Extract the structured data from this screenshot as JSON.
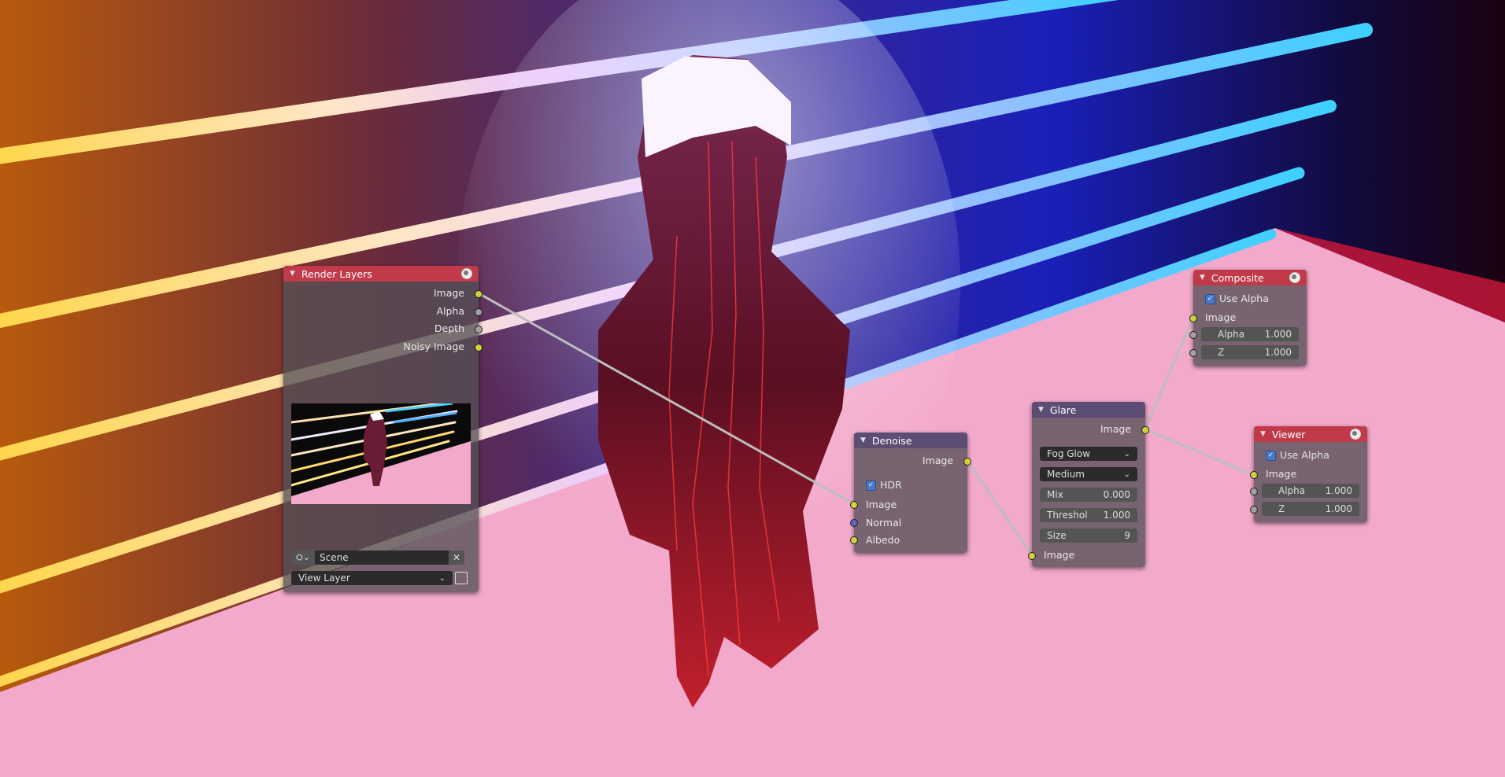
{
  "nodes": {
    "render_layers": {
      "title": "Render Layers",
      "outputs": [
        "Image",
        "Alpha",
        "Depth",
        "Noisy Image"
      ],
      "scene": "Scene",
      "view_layer": "View Layer"
    },
    "denoise": {
      "title": "Denoise",
      "output": "Image",
      "hdr_label": "HDR",
      "inputs": [
        "Image",
        "Normal",
        "Albedo"
      ]
    },
    "glare": {
      "title": "Glare",
      "output": "Image",
      "type": "Fog Glow",
      "quality": "Medium",
      "mix_label": "Mix",
      "mix": "0.000",
      "threshold_label": "Threshol",
      "threshold": "1.000",
      "size_label": "Size",
      "size": "9",
      "input": "Image"
    },
    "composite": {
      "title": "Composite",
      "use_alpha": "Use Alpha",
      "input": "Image",
      "alpha_label": "Alpha",
      "alpha": "1.000",
      "z_label": "Z",
      "z": "1.000"
    },
    "viewer": {
      "title": "Viewer",
      "use_alpha": "Use Alpha",
      "input": "Image",
      "alpha_label": "Alpha",
      "alpha": "1.000",
      "z_label": "Z",
      "z": "1.000"
    }
  },
  "colors": {
    "header_output": "#c03a49",
    "header_filter": "#5d4d74",
    "socket_color": "#d2d13c",
    "socket_value": "#a1a1a1",
    "socket_vector": "#6363c7",
    "floor": "#f3a9cb"
  }
}
